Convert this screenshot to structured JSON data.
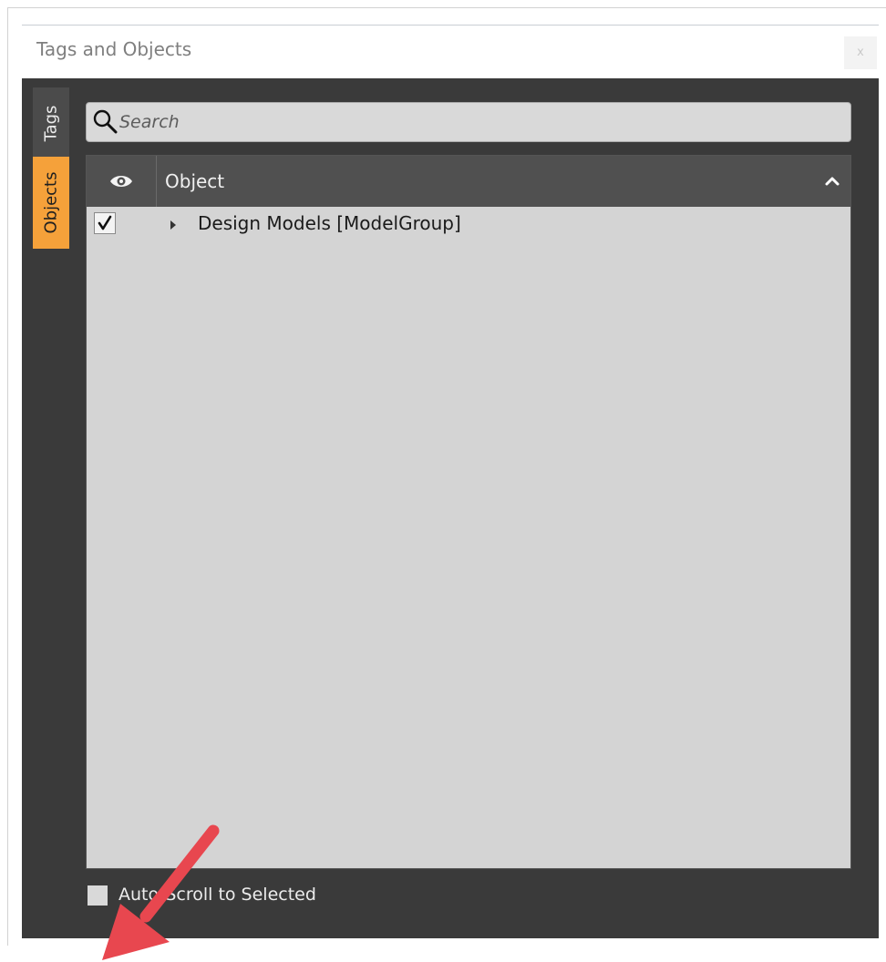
{
  "window": {
    "title": "Tags and Objects",
    "close_label": "x"
  },
  "tabs": [
    {
      "label": "Tags",
      "active": false
    },
    {
      "label": "Objects",
      "active": true
    }
  ],
  "search": {
    "placeholder": "Search",
    "value": ""
  },
  "table": {
    "visibility_column_icon": "eye-icon",
    "object_column_label": "Object",
    "sort_icon": "chevron-up-icon",
    "rows": [
      {
        "checked": true,
        "expander_icon": "expand-arrow-icon",
        "label": "Design Models [ModelGroup]"
      }
    ]
  },
  "footer": {
    "auto_scroll_label": "Auto-Scroll to Selected",
    "auto_scroll_checked": false
  },
  "colors": {
    "panel_bg": "#3a3a3a",
    "active_tab": "#f5a13a",
    "annotation_arrow": "#e8474f"
  }
}
